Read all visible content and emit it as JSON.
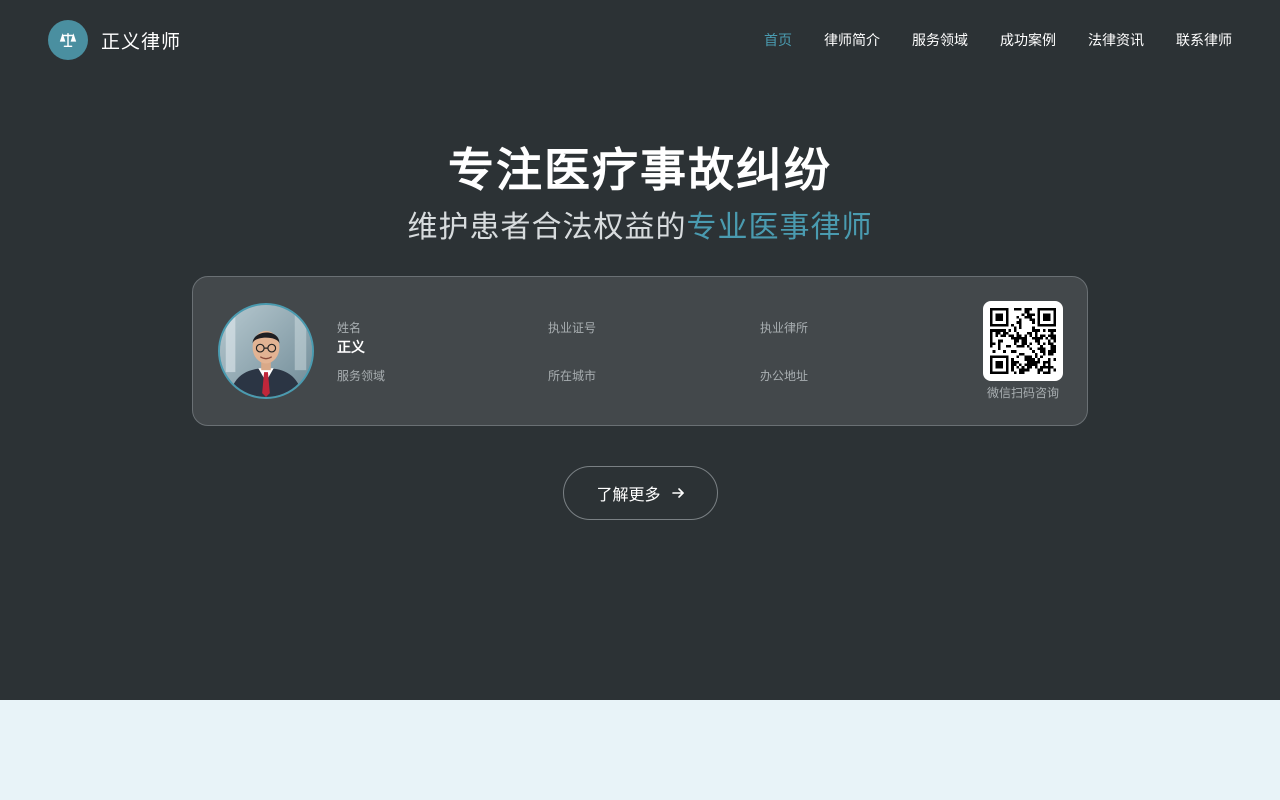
{
  "brand": {
    "name": "正义律师",
    "icon": "scales-icon",
    "color": "#4a8fa0"
  },
  "nav": {
    "items": [
      {
        "label": "首页",
        "active": true
      },
      {
        "label": "律师简介",
        "active": false
      },
      {
        "label": "服务领域",
        "active": false
      },
      {
        "label": "成功案例",
        "active": false
      },
      {
        "label": "法律资讯",
        "active": false
      },
      {
        "label": "联系律师",
        "active": false
      }
    ]
  },
  "hero": {
    "title": "专注医疗事故纠纷",
    "subtitle_plain": "维护患者合法权益的",
    "subtitle_highlight": "专业医事律师"
  },
  "profile": {
    "fields": [
      {
        "label": "姓名",
        "value": "正义"
      },
      {
        "label": "执业证号",
        "value": ""
      },
      {
        "label": "执业律所",
        "value": ""
      },
      {
        "label": "服务领域",
        "value": ""
      },
      {
        "label": "所在城市",
        "value": ""
      },
      {
        "label": "办公地址",
        "value": ""
      }
    ],
    "qr_caption": "微信扫码咨询"
  },
  "cta": {
    "label": "了解更多",
    "icon": "arrow-right-icon"
  },
  "colors": {
    "hero_bg": "#2c3235",
    "accent": "#4a9bb0",
    "card_bg": "#43484b",
    "page_bg": "#e8f3f8"
  }
}
